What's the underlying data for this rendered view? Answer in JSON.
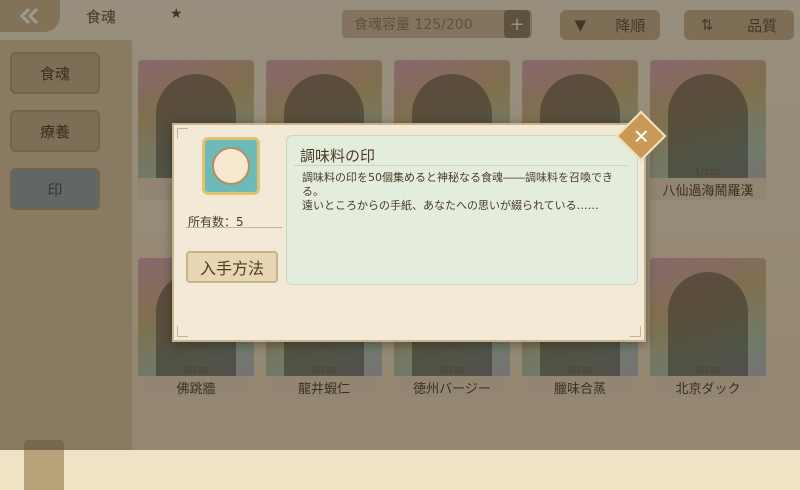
{
  "header": {
    "title": "食魂",
    "capacity": "食魂容量 125/200",
    "plus": "+",
    "sort_label": "降順",
    "sort_icon": "▼",
    "quality_label": "品質",
    "quality_icon": "⇅"
  },
  "sidebar": {
    "tabs": [
      {
        "label": "食魂"
      },
      {
        "label": "療養"
      },
      {
        "label": "印"
      }
    ]
  },
  "grid": {
    "row1": [
      {
        "name": "",
        "count": ""
      },
      {
        "name": "",
        "count": ""
      },
      {
        "name": "",
        "count": ""
      },
      {
        "name": "",
        "count": ""
      },
      {
        "name": "八仙過海鬧羅漢",
        "count": "1/100"
      }
    ],
    "row2": [
      {
        "name": "佛跳牆",
        "count": "0/100"
      },
      {
        "name": "龍井蝦仁",
        "count": "0/100"
      },
      {
        "name": "徳州バージー",
        "count": "0/100"
      },
      {
        "name": "臘味合蒸",
        "count": "0/100"
      },
      {
        "name": "北京ダック",
        "count": "0/100"
      }
    ]
  },
  "modal": {
    "title": "調味料の印",
    "owned": "所有数：5",
    "description_1": "調味料の印を50個集めると神秘なる食魂――調味料を召喚できる。",
    "description_2": "遠いところからの手紙、あなたへの思いが綴られている……",
    "acquire_label": "入手方法",
    "close_label": "✕",
    "icon": "seasoning-seal-icon"
  }
}
